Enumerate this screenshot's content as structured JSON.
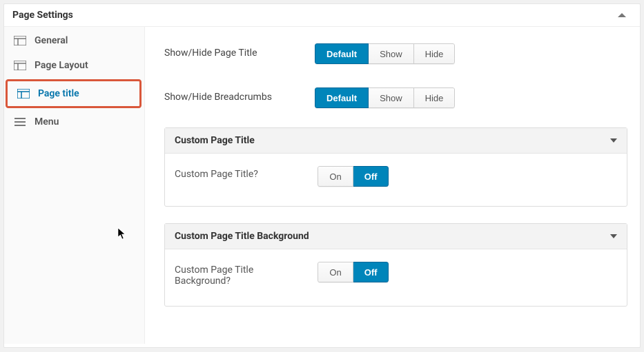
{
  "panel": {
    "title": "Page Settings"
  },
  "sidebar": {
    "items": [
      {
        "label": "General"
      },
      {
        "label": "Page Layout"
      },
      {
        "label": "Page title"
      },
      {
        "label": "Menu"
      }
    ]
  },
  "content": {
    "row_show_title": {
      "label": "Show/Hide Page Title",
      "options": [
        "Default",
        "Show",
        "Hide"
      ],
      "selected": "Default"
    },
    "row_show_breadcrumbs": {
      "label": "Show/Hide Breadcrumbs",
      "options": [
        "Default",
        "Show",
        "Hide"
      ],
      "selected": "Default"
    },
    "accordion_custom_title": {
      "title": "Custom Page Title",
      "row": {
        "label": "Custom Page Title?",
        "options": [
          "On",
          "Off"
        ],
        "selected": "Off"
      }
    },
    "accordion_custom_bg": {
      "title": "Custom Page Title Background",
      "row": {
        "label": "Custom Page Title Background?",
        "options": [
          "On",
          "Off"
        ],
        "selected": "Off"
      }
    }
  }
}
